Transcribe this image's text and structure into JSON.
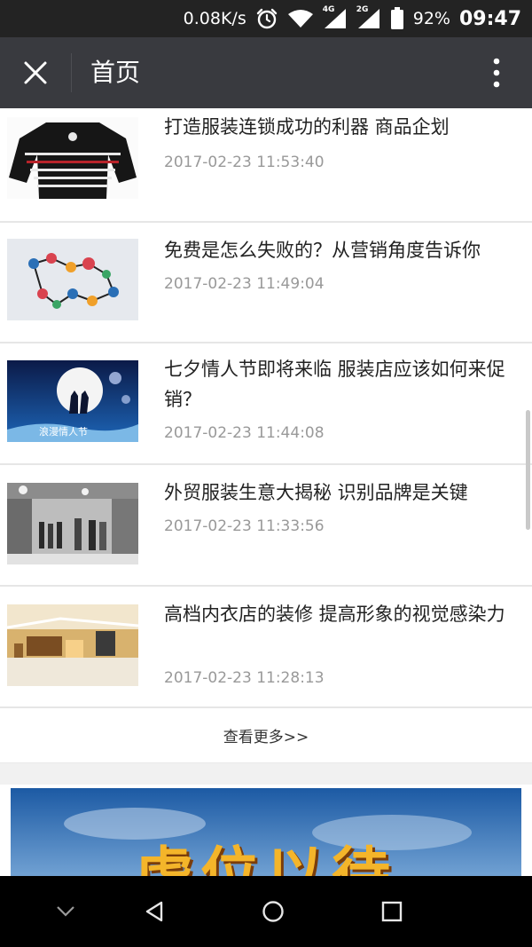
{
  "status_bar": {
    "net_speed": "0.08K/s",
    "net_4g": "4G",
    "net_2g": "2G",
    "battery_pct": "92%",
    "time": "09:47",
    "icons": [
      "alarm-icon",
      "wifi-icon",
      "signal-4g-icon",
      "signal-2g-icon",
      "battery-icon"
    ]
  },
  "title_bar": {
    "title": "首页",
    "close_icon": "close-icon",
    "more_icon": "more-vertical-icon",
    "background": "#393a3f"
  },
  "articles": [
    {
      "title": "打造服装连锁成功的利器 商品企划",
      "date": "2017-02-23 11:53:40",
      "thumb": "striped-sweater"
    },
    {
      "title": "免费是怎么失败的？从营销角度告诉你",
      "date": "2017-02-23 11:49:04",
      "thumb": "network-icons"
    },
    {
      "title": "七夕情人节即将来临 服装店应该如何来促销？",
      "date": "2017-02-23 11:44:08",
      "thumb": "moon-couple",
      "thumb_text": "浪漫情人节"
    },
    {
      "title": "外贸服装生意大揭秘 识别品牌是关键",
      "date": "2017-02-23 11:33:56",
      "thumb": "clothing-store"
    },
    {
      "title": "高档内衣店的装修 提高形象的视觉感染力",
      "date": "2017-02-23 11:28:13",
      "thumb": "store-interior"
    }
  ],
  "more_link": "查看更多>>",
  "banner": {
    "text": "虚位以待"
  },
  "nav_bar": {
    "icons": [
      "chevron-down-icon",
      "back-icon",
      "home-icon",
      "recents-icon"
    ]
  },
  "colors": {
    "title_text": "#222222",
    "date_text": "#999999",
    "divider": "#e6e6e6"
  }
}
